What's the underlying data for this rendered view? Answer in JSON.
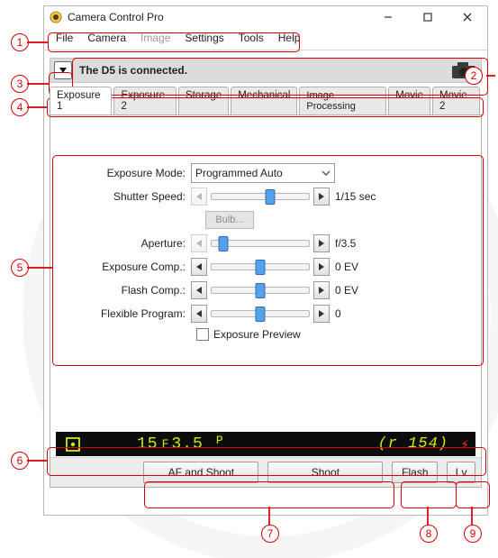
{
  "annotations": {
    "1": "1",
    "2": "2",
    "3": "3",
    "4": "4",
    "5": "5",
    "6": "6",
    "7": "7",
    "8": "8",
    "9": "9"
  },
  "window": {
    "title": "Camera Control Pro"
  },
  "menubar": [
    "File",
    "Camera",
    "Image",
    "Settings",
    "Tools",
    "Help"
  ],
  "menubar_disabled_index": 2,
  "status": {
    "text": "The D5 is connected."
  },
  "tabs": [
    "Exposure 1",
    "Exposure 2",
    "Storage",
    "Mechanical",
    "Image Processing",
    "Movie",
    "Movie 2"
  ],
  "active_tab": 0,
  "controls": {
    "exposure_mode": {
      "label": "Exposure Mode:",
      "value": "Programmed Auto"
    },
    "shutter": {
      "label": "Shutter Speed:",
      "value": "1/15 sec",
      "pos": 60
    },
    "bulb": {
      "label": "Bulb..."
    },
    "aperture": {
      "label": "Aperture:",
      "value": "f/3.5",
      "pos": 12
    },
    "ev": {
      "label": "Exposure Comp.:",
      "value": "0 EV",
      "pos": 50
    },
    "flash_comp": {
      "label": "Flash Comp.:",
      "value": "0 EV",
      "pos": 50
    },
    "flex": {
      "label": "Flexible Program:",
      "value": "0",
      "pos": 50
    },
    "preview": {
      "label": "Exposure Preview"
    }
  },
  "sim": {
    "shutter": "15",
    "fprefix": "F",
    "aperture": "3.5",
    "mode": "P",
    "remaining": "(r 154)",
    "flash_glyph": "⚡"
  },
  "buttons": {
    "af_shoot": "AF and Shoot",
    "shoot": "Shoot",
    "flash": "Flash",
    "lv": "Lv"
  }
}
